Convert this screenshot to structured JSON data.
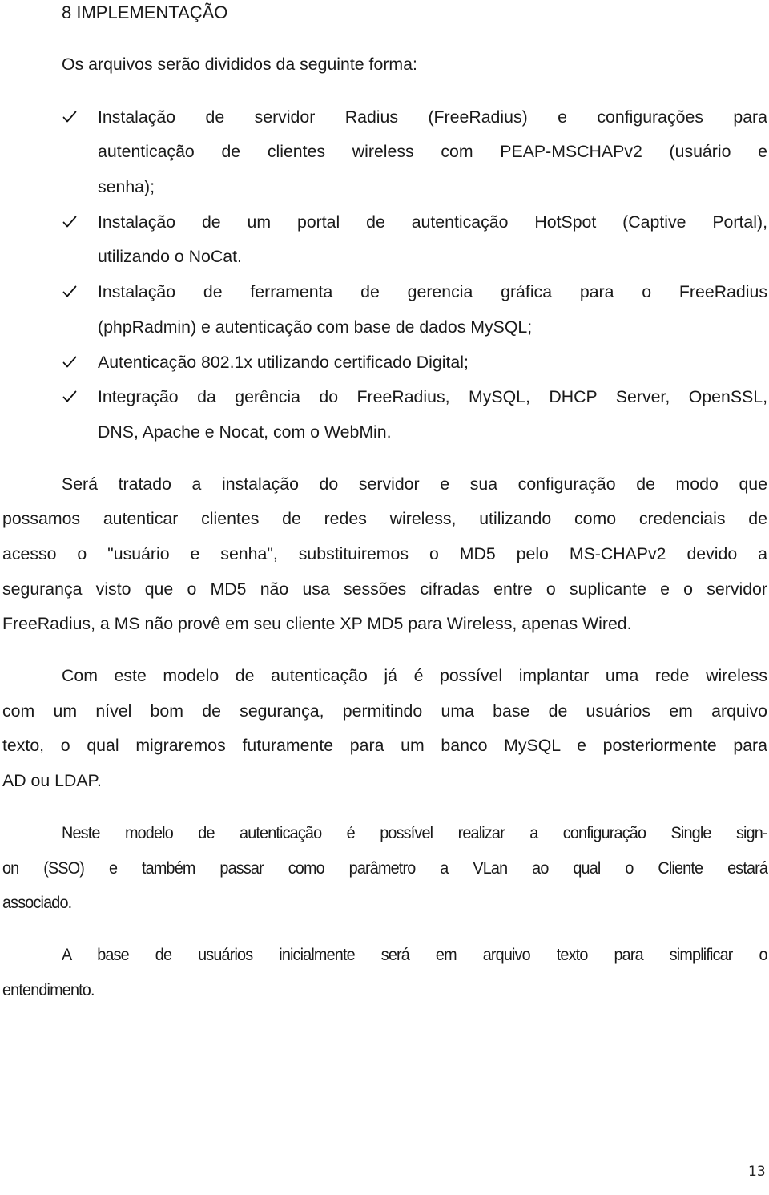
{
  "section": {
    "number": "8",
    "title": "8 IMPLEMENTAÇÃO"
  },
  "intro": "Os arquivos serão divididos da seguinte forma:",
  "bullets": [
    {
      "icon": "checkmark-icon",
      "lines": [
        "Instalação de servidor Radius (FreeRadius) e configurações para",
        "autenticação de clientes wireless com PEAP-MSCHAPv2 (usuário e",
        "senha);"
      ]
    },
    {
      "icon": "checkmark-icon",
      "lines": [
        "Instalação de um portal de autenticação HotSpot (Captive Portal),",
        "utilizando o NoCat."
      ]
    },
    {
      "icon": "checkmark-icon",
      "lines": [
        "Instalação de ferramenta de gerencia gráfica para o FreeRadius",
        "(phpRadmin) e autenticação com base de dados MySQL;"
      ]
    },
    {
      "icon": "checkmark-icon",
      "lines": [
        "Autenticação 802.1x utilizando certificado Digital;"
      ]
    },
    {
      "icon": "checkmark-icon",
      "lines": [
        "Integração da gerência do FreeRadius, MySQL, DHCP Server, OpenSSL,",
        "DNS, Apache e Nocat, com o WebMin."
      ]
    }
  ],
  "paragraphs": [
    {
      "lines": [
        "Será tratado a instalação do servidor e sua configuração de modo que",
        "possamos autenticar clientes de redes wireless, utilizando como credenciais de",
        "acesso o \"usuário e senha\", substituiremos o MD5 pelo MS-CHAPv2 devido a",
        "segurança visto que o MD5 não usa sessões cifradas entre o suplicante e o servidor",
        "FreeRadius, a MS não provê em seu cliente XP MD5 para Wireless, apenas Wired."
      ]
    },
    {
      "lines": [
        "Com este modelo de autenticação já é possível implantar uma rede wireless",
        "com um nível bom de segurança, permitindo uma base de usuários em arquivo",
        "texto, o qual migraremos futuramente para um banco MySQL e posteriormente para",
        "AD ou LDAP."
      ]
    },
    {
      "lines": [
        "Neste modelo de autenticação é possível realizar a configuração Single sign-",
        "on (SSO) e também passar como parâmetro a VLan ao qual o Cliente estará",
        "associado."
      ]
    },
    {
      "lines": [
        "A base de usuários inicialmente será em arquivo texto para simplificar o",
        "entendimento."
      ]
    }
  ],
  "footer": {
    "page_number": "13"
  }
}
